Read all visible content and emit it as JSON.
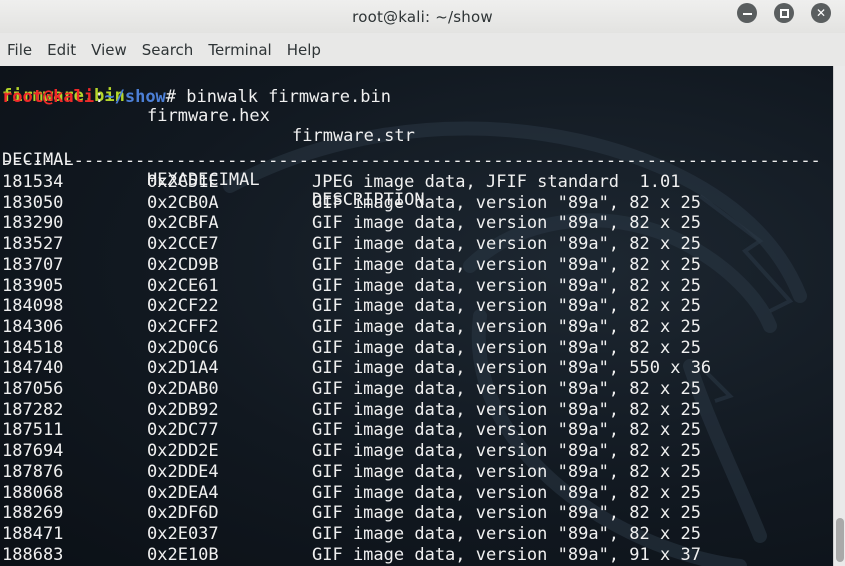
{
  "window": {
    "title": "root@kali: ~/show",
    "minimize_glyph": "",
    "close_glyph": "✕"
  },
  "menu": [
    "File",
    "Edit",
    "View",
    "Search",
    "Terminal",
    "Help"
  ],
  "terminal": {
    "ls_output": [
      "firmware.bin",
      "firmware.hex",
      "firmware.str"
    ],
    "prompt": {
      "user_host": "root@kali",
      "colon": ":",
      "path": "~/show",
      "symbol": "#",
      "command": " binwalk firmware.bin"
    },
    "headers": [
      "DECIMAL",
      "HEXADECIMAL",
      "DESCRIPTION"
    ],
    "separator": "--------------------------------------------------------------------------------",
    "rows": [
      [
        "181534",
        "0x2C51E",
        "JPEG image data, JFIF standard  1.01"
      ],
      [
        "183050",
        "0x2CB0A",
        "GIF image data, version \"89a\", 82 x 25"
      ],
      [
        "183290",
        "0x2CBFA",
        "GIF image data, version \"89a\", 82 x 25"
      ],
      [
        "183527",
        "0x2CCE7",
        "GIF image data, version \"89a\", 82 x 25"
      ],
      [
        "183707",
        "0x2CD9B",
        "GIF image data, version \"89a\", 82 x 25"
      ],
      [
        "183905",
        "0x2CE61",
        "GIF image data, version \"89a\", 82 x 25"
      ],
      [
        "184098",
        "0x2CF22",
        "GIF image data, version \"89a\", 82 x 25"
      ],
      [
        "184306",
        "0x2CFF2",
        "GIF image data, version \"89a\", 82 x 25"
      ],
      [
        "184518",
        "0x2D0C6",
        "GIF image data, version \"89a\", 82 x 25"
      ],
      [
        "184740",
        "0x2D1A4",
        "GIF image data, version \"89a\", 550 x 36"
      ],
      [
        "187056",
        "0x2DAB0",
        "GIF image data, version \"89a\", 82 x 25"
      ],
      [
        "187282",
        "0x2DB92",
        "GIF image data, version \"89a\", 82 x 25"
      ],
      [
        "187511",
        "0x2DC77",
        "GIF image data, version \"89a\", 82 x 25"
      ],
      [
        "187694",
        "0x2DD2E",
        "GIF image data, version \"89a\", 82 x 25"
      ],
      [
        "187876",
        "0x2DDE4",
        "GIF image data, version \"89a\", 82 x 25"
      ],
      [
        "188068",
        "0x2DEA4",
        "GIF image data, version \"89a\", 82 x 25"
      ],
      [
        "188269",
        "0x2DF6D",
        "GIF image data, version \"89a\", 82 x 25"
      ],
      [
        "188471",
        "0x2E037",
        "GIF image data, version \"89a\", 82 x 25"
      ],
      [
        "188683",
        "0x2E10B",
        "GIF image data, version \"89a\", 91 x 37"
      ]
    ]
  },
  "colors": {
    "terminal_bg": "#111820",
    "terminal_fg": "#f0f0f0",
    "executable_green": "#b4d52a",
    "prompt_red": "#ef2929",
    "path_blue": "#4c7fd6"
  },
  "icons": {
    "minimize": "minimize-icon",
    "maximize": "maximize-icon",
    "close": "close-icon"
  }
}
